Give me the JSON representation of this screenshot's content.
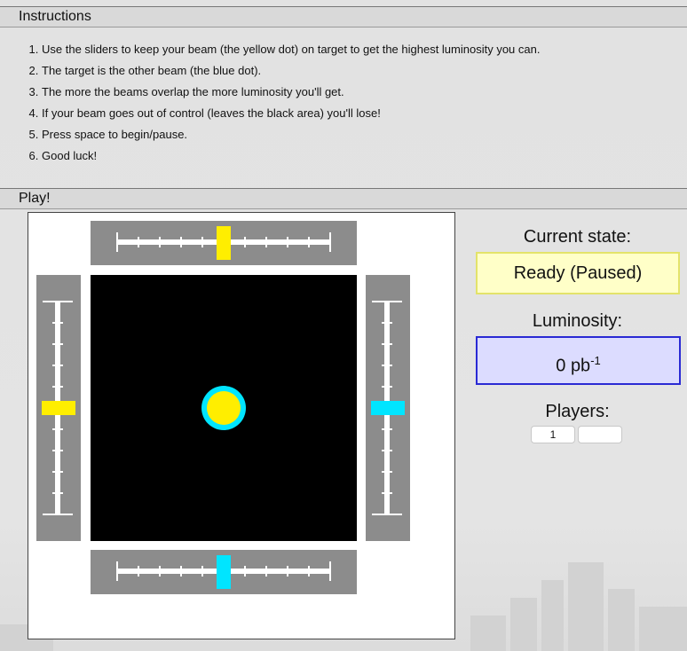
{
  "instructions": {
    "heading": "Instructions",
    "items": [
      "Use the sliders to keep your beam (the yellow dot) on target to get the highest luminosity you can.",
      "The target is the other beam (the blue dot).",
      "The more the beams overlap the more luminosity you'll get.",
      "If your beam goes out of control (leaves the black area) you'll lose!",
      "Press space to begin/pause.",
      "Good luck!"
    ]
  },
  "play": {
    "heading": "Play!",
    "current_state_label": "Current state:",
    "current_state_value": "Ready (Paused)",
    "luminosity_label": "Luminosity:",
    "luminosity_value": "0",
    "luminosity_unit": "pb",
    "luminosity_exponent": "-1",
    "players_label": "Players:",
    "players_value": "1",
    "players_second_value": ""
  },
  "colors": {
    "player_beam": "#ffee00",
    "target_beam": "#00e5ff",
    "player_knob": "#ffee00",
    "target_knob": "#00e5ff"
  },
  "sliders": {
    "top": {
      "beam": "player",
      "value": 0.5
    },
    "bottom": {
      "beam": "target",
      "value": 0.5
    },
    "left": {
      "beam": "player",
      "value": 0.5
    },
    "right": {
      "beam": "target",
      "value": 0.5
    }
  }
}
